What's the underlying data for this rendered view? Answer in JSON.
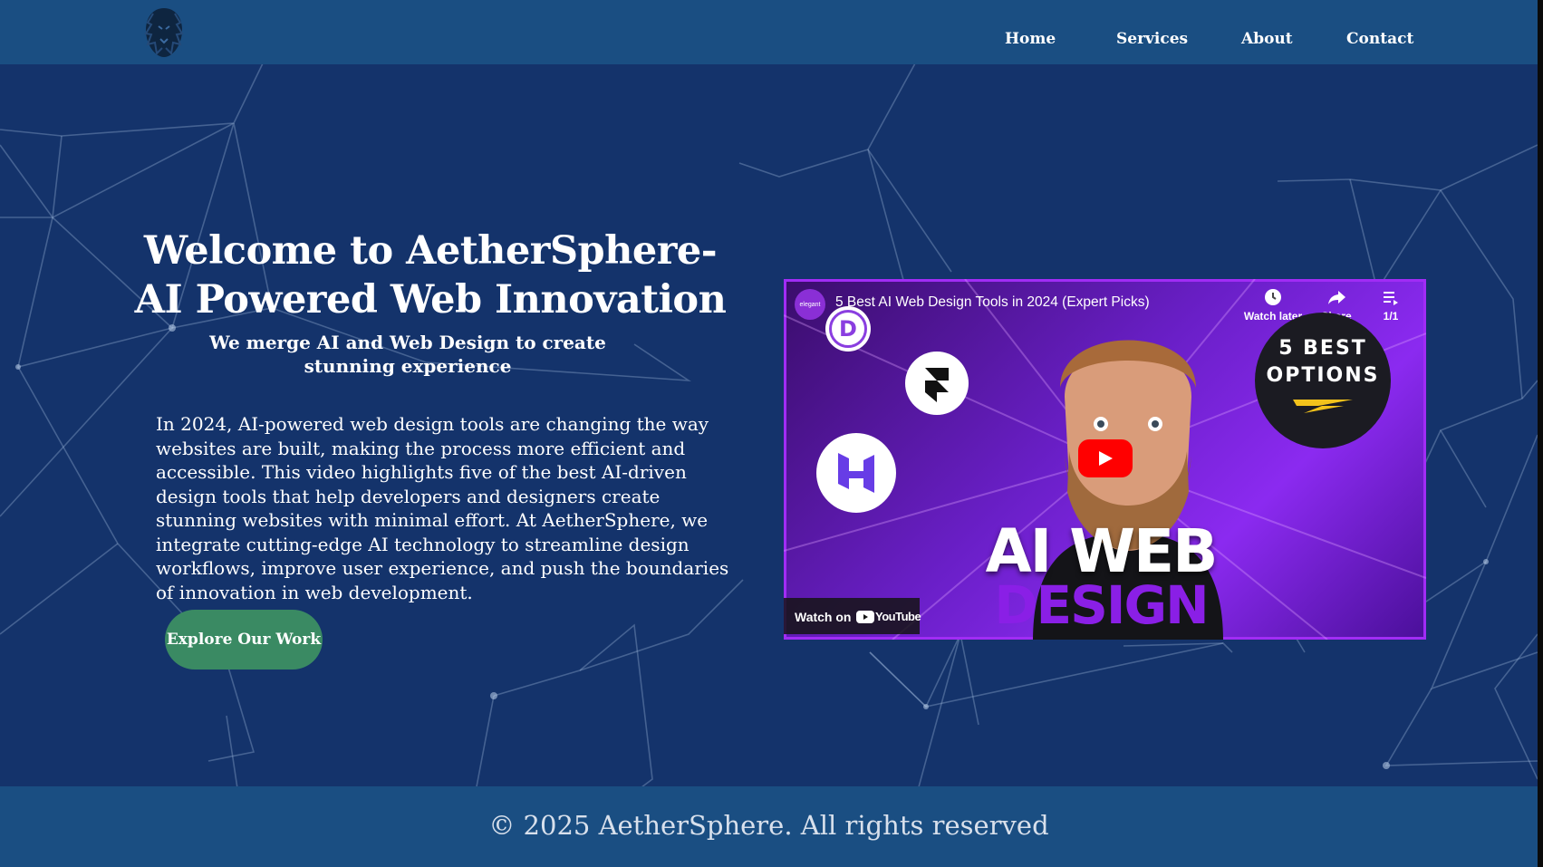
{
  "header": {
    "logo_alt": "lion-head-logo",
    "nav": [
      {
        "label": "Home"
      },
      {
        "label": "Services"
      },
      {
        "label": "About"
      },
      {
        "label": "Contact"
      }
    ]
  },
  "hero": {
    "title": "Welcome to AetherSphere- AI Powered Web Innovation",
    "subtitle": "We merge AI and Web Design to create stunning experience",
    "body": "In 2024, AI-powered web design tools are changing the way websites are built, making the process more efficient and accessible. This video highlights five of the best AI-driven design tools that help developers and designers create stunning websites with minimal effort. At AetherSphere, we integrate cutting-edge AI technology to streamline design workflows, improve user experience, and push the boundaries of innovation in web development.",
    "cta_label": "Explore Our Work"
  },
  "video": {
    "title": "5 Best AI Web Design Tools in 2024 (Expert Picks)",
    "channel_avatar_text": "elegant",
    "actions": [
      {
        "label": "Watch later",
        "icon": "clock-icon"
      },
      {
        "label": "Share",
        "icon": "share-arrow-icon"
      },
      {
        "label": "1/1",
        "icon": "playlist-icon"
      }
    ],
    "divi_letter": "D",
    "badge_line1": "5 BEST",
    "badge_line2": "OPTIONS",
    "overlay_line1": "AI WEB",
    "overlay_line2": "DESIGN",
    "watch_on": "Watch on",
    "youtube_word": "YouTube"
  },
  "footer": {
    "copyright": "© 2025 AetherSphere. All rights reserved"
  },
  "colors": {
    "page_bg": "#14336b",
    "header_bg": "#1a4e82",
    "cta_bg": "#3a8a63",
    "video_accent": "#8a1fe6",
    "play_red": "#ff0000"
  }
}
